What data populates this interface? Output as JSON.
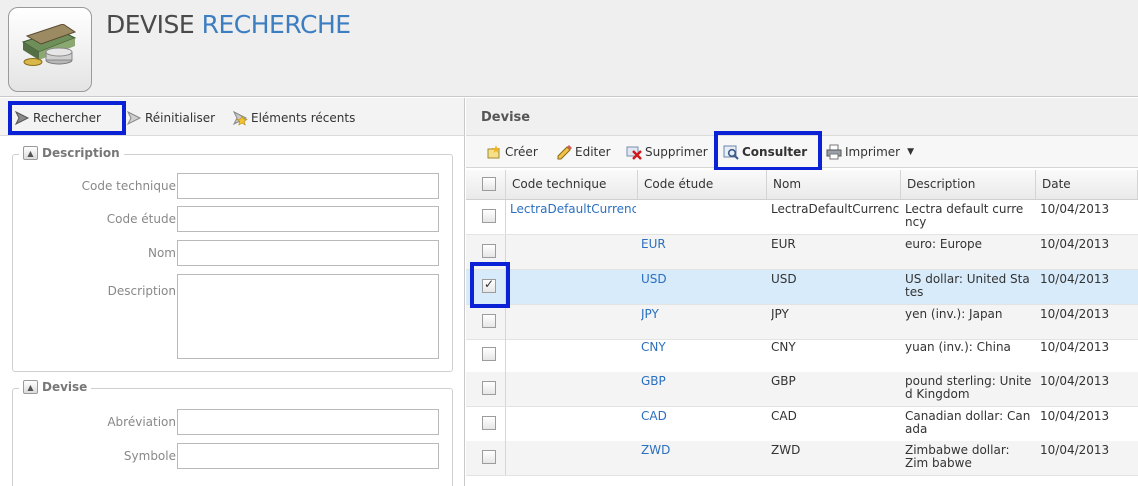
{
  "header": {
    "title_part1": "DEVISE",
    "title_part2": "RECHERCHE",
    "logo_icon": "money-stack-icon"
  },
  "left_toolbar": {
    "search_label": "Rechercher",
    "reset_label": "Réinitialiser",
    "recent_label": "Eléments récents"
  },
  "description_section": {
    "legend": "Description",
    "fields": {
      "code_technique": {
        "label": "Code technique",
        "value": ""
      },
      "code_etude": {
        "label": "Code étude",
        "value": ""
      },
      "nom": {
        "label": "Nom",
        "value": ""
      },
      "description": {
        "label": "Description",
        "value": ""
      }
    }
  },
  "devise_section": {
    "legend": "Devise",
    "fields": {
      "abreviation": {
        "label": "Abréviation",
        "value": ""
      },
      "symbole": {
        "label": "Symbole",
        "value": ""
      }
    }
  },
  "right_panel": {
    "title": "Devise",
    "toolbar": {
      "create_label": "Créer",
      "edit_label": "Editer",
      "delete_label": "Supprimer",
      "view_label": "Consulter",
      "print_label": "Imprimer"
    },
    "columns": [
      "Code technique",
      "Code étude",
      "Nom",
      "Description",
      "Date"
    ],
    "rows": [
      {
        "code_technique": "LectraDefaultCurrenc",
        "code_etude": "",
        "nom": "LectraDefaultCurrenc",
        "description": "Lectra default curre ncy",
        "date": "10/04/2013",
        "checked": false
      },
      {
        "code_technique": "",
        "code_etude": "EUR",
        "nom": "EUR",
        "description": "euro: Europe",
        "date": "10/04/2013",
        "checked": false
      },
      {
        "code_technique": "",
        "code_etude": "USD",
        "nom": "USD",
        "description": "US dollar: United Sta tes",
        "date": "10/04/2013",
        "checked": true
      },
      {
        "code_technique": "",
        "code_etude": "JPY",
        "nom": "JPY",
        "description": "yen (inv.): Japan",
        "date": "10/04/2013",
        "checked": false
      },
      {
        "code_technique": "",
        "code_etude": "CNY",
        "nom": "CNY",
        "description": "yuan (inv.): China",
        "date": "10/04/2013",
        "checked": false
      },
      {
        "code_technique": "",
        "code_etude": "GBP",
        "nom": "GBP",
        "description": "pound sterling: Unite d Kingdom",
        "date": "10/04/2013",
        "checked": false
      },
      {
        "code_technique": "",
        "code_etude": "CAD",
        "nom": "CAD",
        "description": "Canadian dollar: Can ada",
        "date": "10/04/2013",
        "checked": false
      },
      {
        "code_technique": "",
        "code_etude": "ZWD",
        "nom": "ZWD",
        "description": "Zimbabwe dollar: Zim babwe",
        "date": "10/04/2013",
        "checked": false
      }
    ]
  },
  "colors": {
    "highlight": "#0a21d6",
    "link": "#2a6fc0",
    "selected_row": "#d8ebfb"
  }
}
